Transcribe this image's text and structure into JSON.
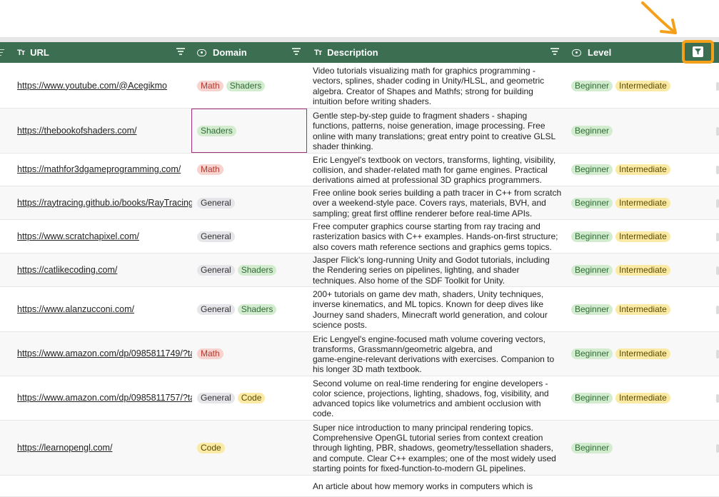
{
  "columns": [
    {
      "label": "URL",
      "icon": "text-type-icon"
    },
    {
      "label": "Domain",
      "icon": "select-type-icon"
    },
    {
      "label": "Description",
      "icon": "text-type-icon"
    },
    {
      "label": "Level",
      "icon": "select-type-icon"
    }
  ],
  "colors": {
    "header": "#3c6e52",
    "highlight": "#f5a01a",
    "selection": "#a0307a"
  },
  "rows": [
    {
      "url": "https://www.youtube.com/@Acegikmo",
      "domains": [
        "Math",
        "Shaders"
      ],
      "desc": [
        "Video tutorials visualizing math for graphics programming -",
        "vectors, splines, shader coding in Unity/HLSL, and geometric",
        "algebra. Creator of Shapes and Mathfs; strong for building",
        "intuition before writing shaders."
      ],
      "levels": [
        "Beginner",
        "Intermediate"
      ]
    },
    {
      "url": "https://thebookofshaders.com/",
      "domains": [
        "Shaders"
      ],
      "desc": [
        "Gentle step-by-step guide to fragment shaders - shaping",
        "functions, patterns, noise generation, image processing. Free",
        "online with many translations; great entry point to creative GLSL",
        "shader thinking."
      ],
      "levels": [
        "Beginner"
      ]
    },
    {
      "url": "https://mathfor3dgameprogramming.com/",
      "domains": [
        "Math"
      ],
      "desc": [
        "Eric Lengyel's textbook on vectors, transforms, lighting, visibility,",
        "collision, and shader-related math for game engines. Practical",
        "derivations aimed at professional 3D graphics programmers."
      ],
      "levels": [
        "Beginner",
        "Intermediate"
      ]
    },
    {
      "url": "https://raytracing.github.io/books/RayTracingI",
      "domains": [
        "General"
      ],
      "desc": [
        "Free online book series building a path tracer in C++ from scratch",
        "over a weekend-style pace. Covers rays, materials, BVH, and",
        "sampling; great first offline renderer before real-time APIs."
      ],
      "levels": [
        "Beginner",
        "Intermediate"
      ]
    },
    {
      "url": "https://www.scratchapixel.com/",
      "domains": [
        "General"
      ],
      "desc": [
        "Free computer graphics course starting from ray tracing and",
        "rasterization basics with C++ examples. Hands-on-first structure;",
        "also covers math reference sections and graphics gems topics."
      ],
      "levels": [
        "Beginner",
        "Intermediate"
      ]
    },
    {
      "url": "https://catlikecoding.com/",
      "domains": [
        "General",
        "Shaders"
      ],
      "desc": [
        "Jasper Flick's long-running Unity and Godot tutorials, including",
        "the Rendering series on pipelines, lighting, and shader",
        "techniques. Also home of the SDF Toolkit for Unity."
      ],
      "levels": [
        "Beginner",
        "Intermediate"
      ]
    },
    {
      "url": "https://www.alanzucconi.com/",
      "domains": [
        "General",
        "Shaders"
      ],
      "desc": [
        "200+ tutorials on game dev math, shaders, Unity techniques,",
        "inverse kinematics, and ML topics. Known for deep dives like",
        "Journey sand shaders, Minecraft world generation, and colour",
        "science posts."
      ],
      "levels": [
        "Beginner",
        "Intermediate"
      ]
    },
    {
      "url": "https://www.amazon.com/dp/0985811749/?ta",
      "domains": [
        "Math"
      ],
      "desc": [
        "Eric Lengyel's engine-focused math volume covering vectors,",
        "transforms, Grassmann/geometric algebra, and",
        "game-engine-relevant derivations with exercises. Companion to",
        "his longer 3D math textbook."
      ],
      "levels": [
        "Beginner",
        "Intermediate"
      ]
    },
    {
      "url": "https://www.amazon.com/dp/0985811757/?ta",
      "domains": [
        "General",
        "Code"
      ],
      "desc": [
        "Second volume on real-time rendering for engine developers -",
        "color science, projections, lighting, shadows, fog, visibility, and",
        "advanced topics like volumetrics and ambient occlusion with",
        "code."
      ],
      "levels": [
        "Beginner",
        "Intermediate"
      ]
    },
    {
      "url": "https://learnopengl.com/",
      "domains": [
        "Code"
      ],
      "desc": [
        "Super nice introduction to many principal rendering topics.",
        "Comprehensive OpenGL tutorial series from context creation",
        "through lighting, PBR, shadows, geometry/tessellation shaders,",
        "and compute. Clear C++ examples; one of the most widely used",
        "starting points for fixed-function-to-modern GL pipelines."
      ],
      "levels": [
        "Beginner"
      ]
    },
    {
      "url": "",
      "domains": [],
      "desc": [
        "An article about how memory works in computers which is"
      ],
      "levels": []
    }
  ]
}
